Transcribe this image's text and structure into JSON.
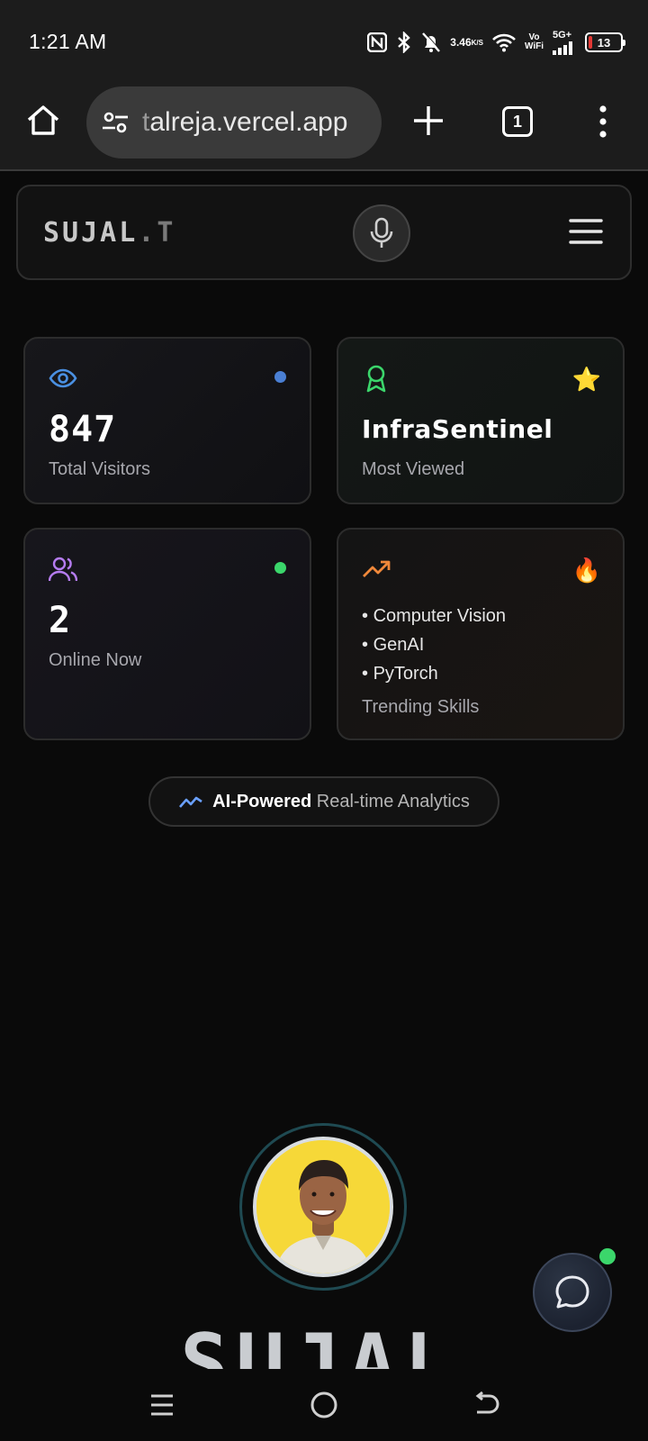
{
  "status_bar": {
    "time": "1:21 AM",
    "net_speed": "3.46",
    "net_unit": "K/S",
    "vowifi_top": "Vo",
    "vowifi_bottom": "WiFi",
    "signal_label": "5G+",
    "battery": "13"
  },
  "browser": {
    "url_prefix": "t",
    "url_rest": "alreja.vercel.app",
    "tab_count": "1"
  },
  "site": {
    "logo_main": "SUJAL",
    "logo_suffix": ".T"
  },
  "stats": {
    "visitors": {
      "value": "847",
      "label": "Total Visitors",
      "dot_color": "#4a7fd4"
    },
    "most_viewed": {
      "value": "InfraSentinel",
      "label": "Most Viewed",
      "emoji": "⭐"
    },
    "online": {
      "value": "2",
      "label": "Online Now",
      "dot_color": "#3bd66b"
    },
    "trending": {
      "items": [
        "Computer Vision",
        "GenAI",
        "PyTorch"
      ],
      "label": "Trending Skills",
      "emoji": "🔥"
    }
  },
  "analytics_pill": {
    "strong": "AI-Powered",
    "rest": "Real-time Analytics"
  },
  "hero": {
    "name_partial": "SUJAL"
  },
  "colors": {
    "eye_icon": "#4a90e2",
    "award_icon": "#3bd66b",
    "users_icon": "#b57cf0",
    "trend_icon": "#f0883a",
    "online_dot": "#3bd66b"
  }
}
